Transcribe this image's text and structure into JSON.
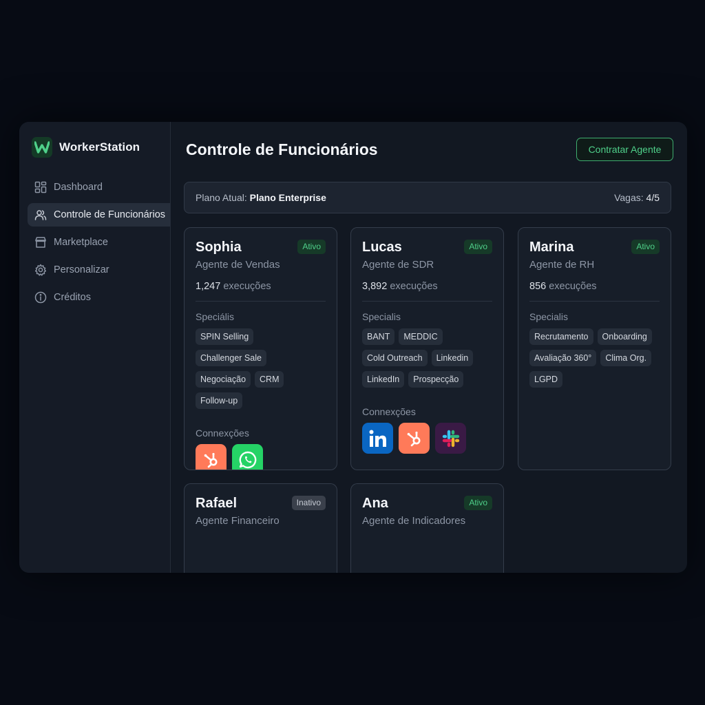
{
  "app": {
    "name": "WorkerStation"
  },
  "sidebar": {
    "items": [
      {
        "label": "Dashboard",
        "icon": "grid-icon",
        "active": false
      },
      {
        "label": "Controle de Funcionários",
        "icon": "users-icon",
        "active": true
      },
      {
        "label": "Marketplace",
        "icon": "store-icon",
        "active": false
      },
      {
        "label": "Personalizar",
        "icon": "gear-icon",
        "active": false
      },
      {
        "label": "Créditos",
        "icon": "info-icon",
        "active": false
      }
    ]
  },
  "header": {
    "title": "Controle de Funcionários",
    "hire_label": "Contratar Agente"
  },
  "plan": {
    "label": "Plano Atual:",
    "value": "Plano Enterprise",
    "slots_label": "Vagas:",
    "slots_value": "4/5"
  },
  "colors": {
    "accent": "#4fd08a",
    "background": "#070b14",
    "panel": "#121822"
  },
  "agents": [
    {
      "name": "Sophia",
      "status": "Ativo",
      "role": "Agente de Vendas",
      "executions": "1,247",
      "executions_label": "execuções",
      "skills_label": "Speciális",
      "skills": [
        "SPIN Selling",
        "Challenger Sale",
        "Negociação",
        "CRM",
        "Follow-up"
      ],
      "connections_label": "Connexções",
      "connections": [
        "hubspot-icon",
        "whatsapp-icon"
      ]
    },
    {
      "name": "Lucas",
      "status": "Ativo",
      "role": "Agente de SDR",
      "executions": "3,892",
      "executions_label": "execuções",
      "skills_label": "Specialis",
      "skills": [
        "BANT",
        "MEDDIC",
        "Cold Outreach",
        "Linkedin",
        "LinkedIn",
        "Prospecção"
      ],
      "connections_label": "Connexções",
      "connections": [
        "linkedin-icon",
        "hubspot-icon",
        "slack-icon"
      ]
    },
    {
      "name": "Marina",
      "status": "Ativo",
      "role": "Agente de RH",
      "executions": "856",
      "executions_label": "execuções",
      "skills_label": "Specialis",
      "skills": [
        "Recrutamento",
        "Onboarding",
        "Avaliação 360°",
        "Clima Org.",
        "LGPD"
      ]
    },
    {
      "name": "Rafael",
      "status": "Inativo",
      "role": "Agente Financeiro"
    },
    {
      "name": "Ana",
      "status": "Ativo",
      "role": "Agente de Indicadores"
    }
  ]
}
